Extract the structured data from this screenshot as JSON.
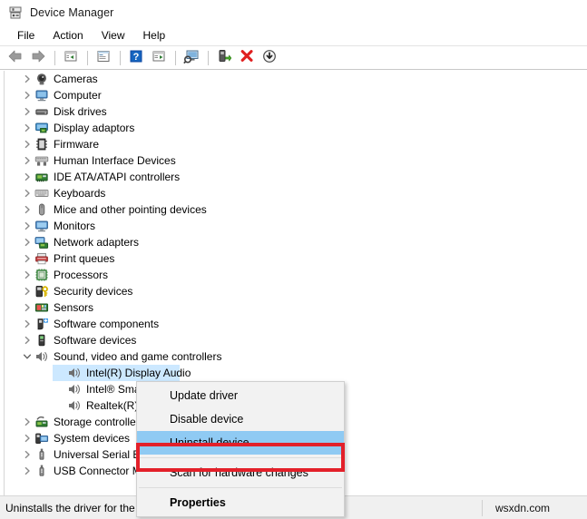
{
  "window": {
    "title": "Device Manager",
    "title_icon": "device-manager-icon"
  },
  "menubar": {
    "items": [
      {
        "label": "File",
        "name": "menu-file"
      },
      {
        "label": "Action",
        "name": "menu-action"
      },
      {
        "label": "View",
        "name": "menu-view"
      },
      {
        "label": "Help",
        "name": "menu-help"
      }
    ]
  },
  "toolbar": {
    "buttons": [
      {
        "icon": "back-arrow-icon",
        "title": "Back"
      },
      {
        "icon": "forward-arrow-icon",
        "title": "Forward"
      },
      {
        "icon": "up-one-level-icon",
        "title": "Up one level"
      },
      {
        "icon": "show-hide-console-tree-icon",
        "title": "Show/Hide Console Tree"
      },
      {
        "icon": "help-icon",
        "title": "Help"
      },
      {
        "icon": "properties-icon",
        "title": "Properties"
      },
      {
        "icon": "scan-hardware-changes-icon",
        "title": "Scan for hardware changes"
      },
      {
        "icon": "update-driver-icon",
        "title": "Update driver"
      },
      {
        "icon": "uninstall-device-icon",
        "title": "Uninstall device"
      },
      {
        "icon": "disable-device-icon",
        "title": "Disable device"
      }
    ]
  },
  "tree": {
    "nodes": [
      {
        "label": "Cameras",
        "icon": "camera-icon",
        "level": 1,
        "expanded": false,
        "selected": false
      },
      {
        "label": "Computer",
        "icon": "computer-icon",
        "level": 1,
        "expanded": false,
        "selected": false
      },
      {
        "label": "Disk drives",
        "icon": "disk-drive-icon",
        "level": 1,
        "expanded": false,
        "selected": false
      },
      {
        "label": "Display adaptors",
        "icon": "display-adapter-icon",
        "level": 1,
        "expanded": false,
        "selected": false
      },
      {
        "label": "Firmware",
        "icon": "firmware-icon",
        "level": 1,
        "expanded": false,
        "selected": false
      },
      {
        "label": "Human Interface Devices",
        "icon": "hid-icon",
        "level": 1,
        "expanded": false,
        "selected": false
      },
      {
        "label": "IDE ATA/ATAPI controllers",
        "icon": "ide-controller-icon",
        "level": 1,
        "expanded": false,
        "selected": false
      },
      {
        "label": "Keyboards",
        "icon": "keyboard-icon",
        "level": 1,
        "expanded": false,
        "selected": false
      },
      {
        "label": "Mice and other pointing devices",
        "icon": "mouse-icon",
        "level": 1,
        "expanded": false,
        "selected": false
      },
      {
        "label": "Monitors",
        "icon": "monitor-icon",
        "level": 1,
        "expanded": false,
        "selected": false
      },
      {
        "label": "Network adapters",
        "icon": "network-adapter-icon",
        "level": 1,
        "expanded": false,
        "selected": false
      },
      {
        "label": "Print queues",
        "icon": "printer-icon",
        "level": 1,
        "expanded": false,
        "selected": false
      },
      {
        "label": "Processors",
        "icon": "processor-icon",
        "level": 1,
        "expanded": false,
        "selected": false
      },
      {
        "label": "Security devices",
        "icon": "security-device-icon",
        "level": 1,
        "expanded": false,
        "selected": false
      },
      {
        "label": "Sensors",
        "icon": "sensor-icon",
        "level": 1,
        "expanded": false,
        "selected": false
      },
      {
        "label": "Software components",
        "icon": "software-component-icon",
        "level": 1,
        "expanded": false,
        "selected": false
      },
      {
        "label": "Software devices",
        "icon": "software-device-icon",
        "level": 1,
        "expanded": false,
        "selected": false
      },
      {
        "label": "Sound, video and game controllers",
        "icon": "speaker-icon",
        "level": 1,
        "expanded": true,
        "selected": false
      },
      {
        "label": "Intel(R) Display Audio",
        "icon": "speaker-icon",
        "level": 2,
        "expanded": null,
        "selected": true
      },
      {
        "label": "Intel® Smart Sound Technology",
        "icon": "speaker-icon",
        "level": 2,
        "expanded": null,
        "selected": false
      },
      {
        "label": "Realtek(R) Audio",
        "icon": "speaker-icon",
        "level": 2,
        "expanded": null,
        "selected": false
      },
      {
        "label": "Storage controllers",
        "icon": "storage-controller-icon",
        "level": 1,
        "expanded": false,
        "selected": false
      },
      {
        "label": "System devices",
        "icon": "system-device-icon",
        "level": 1,
        "expanded": false,
        "selected": false
      },
      {
        "label": "Universal Serial Bus controllers",
        "icon": "usb-icon",
        "level": 1,
        "expanded": false,
        "selected": false
      },
      {
        "label": "USB Connector Managers",
        "icon": "usb-icon",
        "level": 1,
        "expanded": false,
        "selected": false
      }
    ]
  },
  "context_menu": {
    "items": [
      {
        "label": "Update driver",
        "highlighted": false,
        "bold": false,
        "separator_before": false
      },
      {
        "label": "Disable device",
        "highlighted": false,
        "bold": false,
        "separator_before": false
      },
      {
        "label": "Uninstall device",
        "highlighted": true,
        "bold": false,
        "separator_before": false
      },
      {
        "label": "Scan for hardware changes",
        "highlighted": false,
        "bold": false,
        "separator_before": true
      },
      {
        "label": "Properties",
        "highlighted": false,
        "bold": true,
        "separator_before": true
      }
    ],
    "highlight_color": "#8fcaf3",
    "annotation_box_color": "#e3202a"
  },
  "statusbar": {
    "message": "Uninstalls the driver for the selected device.",
    "right_text": "wsxdn.com"
  },
  "ghost": {
    "text": "——————————————————"
  }
}
